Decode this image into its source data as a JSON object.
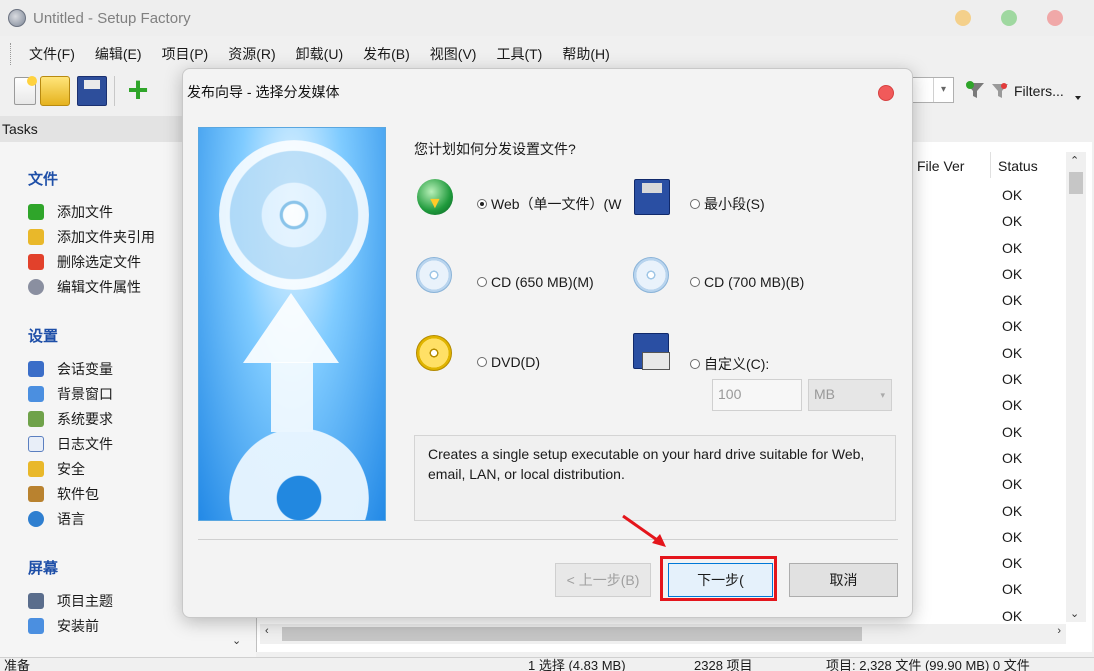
{
  "window": {
    "title": "Untitled - Setup Factory"
  },
  "menu": [
    "文件(F)",
    "编辑(E)",
    "项目(P)",
    "资源(R)",
    "卸载(U)",
    "发布(B)",
    "视图(V)",
    "工具(T)",
    "帮助(H)"
  ],
  "toolbar": {
    "filters_label": "Filters..."
  },
  "tasks": {
    "header": "Tasks",
    "sections": [
      {
        "title": "文件",
        "items": [
          "添加文件",
          "添加文件夹引用",
          "删除选定文件",
          "编辑文件属性"
        ]
      },
      {
        "title": "设置",
        "items": [
          "会话变量",
          "背景窗口",
          "系统要求",
          "日志文件",
          "安全",
          "软件包",
          "语言"
        ]
      },
      {
        "title": "屏幕",
        "items": [
          "项目主题",
          "安装前"
        ]
      }
    ]
  },
  "file_list": {
    "columns": [
      "File Ver",
      "Status"
    ],
    "status_values": [
      "OK",
      "OK",
      "OK",
      "OK",
      "OK",
      "OK",
      "OK",
      "OK",
      "OK",
      "OK",
      "OK",
      "OK",
      "OK",
      "OK",
      "OK",
      "OK",
      "OK"
    ]
  },
  "statusbar": {
    "left": "准备",
    "selected": "1 选择 (4.83 MB)",
    "items": "2328 项目",
    "project": "项目: 2,328 文件 (99.90 MB) 0 文件"
  },
  "dialog": {
    "title": "发布向导 - 选择分发媒体",
    "question": "您计划如何分发设置文件?",
    "options": {
      "web": "Web（单一文件）(W",
      "minimal": "最小段(S)",
      "cd650": "CD (650 MB)(M)",
      "cd700": "CD (700 MB)(B)",
      "dvd": "DVD(D)",
      "custom": "自定义(C):"
    },
    "custom_size": "100",
    "custom_unit": "MB",
    "description": "Creates a single setup executable on your hard drive suitable for Web, email, LAN, or local distribution.",
    "buttons": {
      "back": "< 上一步(B)",
      "next": "下一步(",
      "cancel": "取消"
    }
  }
}
